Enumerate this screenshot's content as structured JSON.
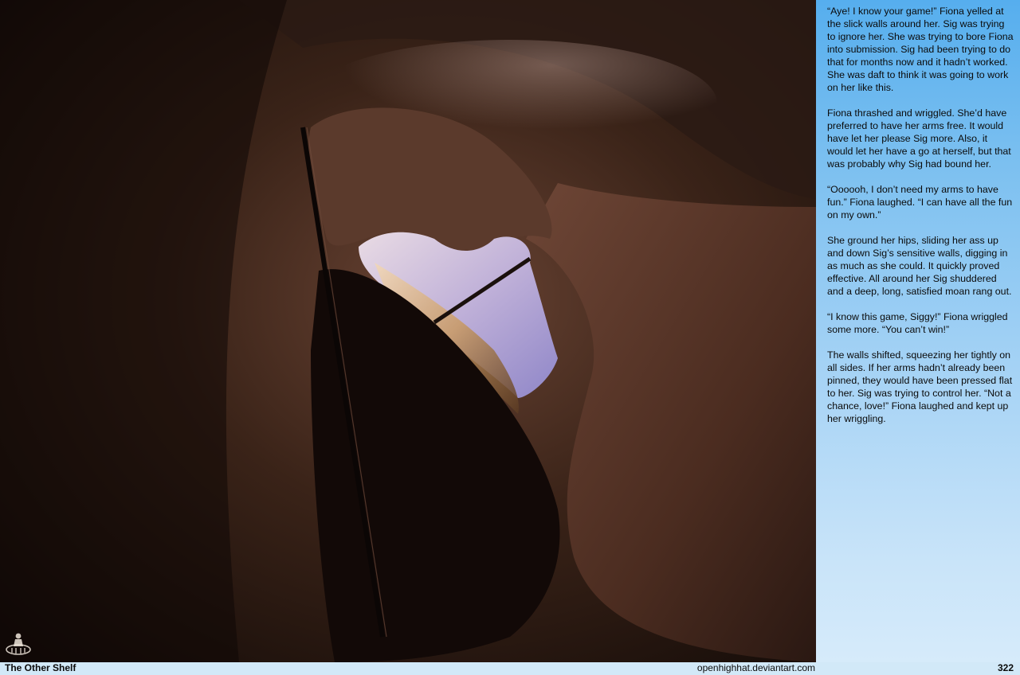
{
  "story": {
    "paragraphs": [
      "“Aye! I know your game!” Fiona yelled at the slick walls around her. Sig was trying to ignore her. She was trying to bore Fiona into submission. Sig had been trying to do that for months now and it hadn’t worked. She was daft to think it was going to work on her like this.",
      "Fiona thrashed and wriggled. She’d have preferred to have her arms free. It would have let her please Sig more. Also, it would let her have a go at herself, but that was probably why Sig had bound her.",
      "“Oooooh, I don’t need my arms to have fun.” Fiona laughed. “I can have all the fun on my own.”",
      "She ground her hips, sliding her ass up and down Sig’s sensitive walls, digging in as much as she could. It quickly proved effective. All around her Sig shuddered and a deep, long, satisfied moan rang out.",
      "“I know this game, Siggy!” Fiona wriggled some more. “You can’t win!”",
      "The walls shifted, squeezing her tightly on all sides. If her arms hadn’t already been pinned, they would have been pressed flat to her. Sig was trying to control her. “Not a chance, love!” Fiona laughed and kept up her wriggling."
    ]
  },
  "logo": {
    "icon": "creator-logo-icon"
  },
  "footer": {
    "title": "The Other Shelf",
    "website": "openhighhat.deviantart.com",
    "page_number": "322"
  },
  "colors": {
    "sidebar_top": "#56aeee",
    "sidebar_bottom": "#d6ebfa",
    "footer_bg": "#d2e9f8",
    "text": "#0b0b0b"
  }
}
